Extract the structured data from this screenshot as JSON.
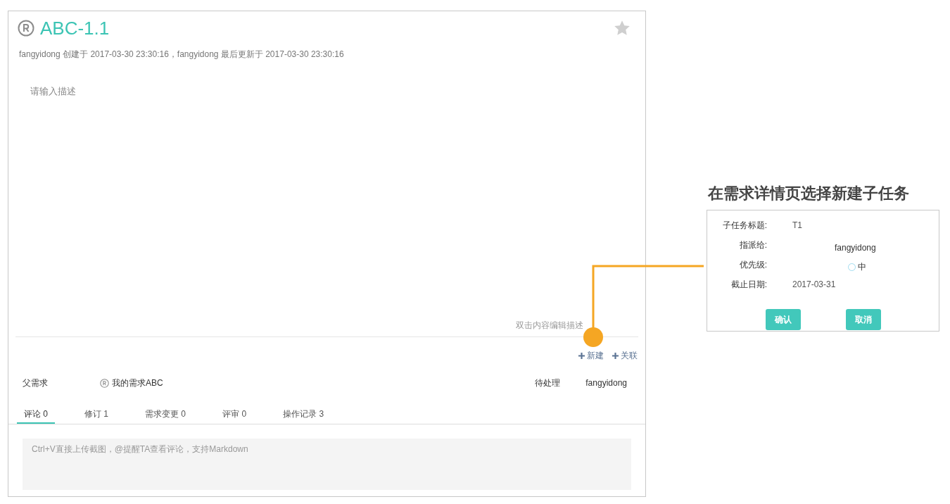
{
  "issue": {
    "title": "ABC-1.1",
    "starred": false,
    "meta": "fangyidong 创建于 2017-03-30 23:30:16，fangyidong 最后更新于 2017-03-30 23:30:16",
    "description_placeholder": "请输入描述",
    "edit_hint": "双击内容编辑描述"
  },
  "actions": [
    "新建",
    "关联"
  ],
  "parent": {
    "label": "父需求",
    "name": "我的需求ABC",
    "status": "待处理",
    "owner": "fangyidong"
  },
  "tabs": [
    {
      "label": "评论 0",
      "selected": true
    },
    {
      "label": "修订 1",
      "selected": false
    },
    {
      "label": "需求变更 0",
      "selected": false
    },
    {
      "label": "评审 0",
      "selected": false
    },
    {
      "label": "操作记录 3",
      "selected": false
    }
  ],
  "comment": {
    "placeholder": "Ctrl+V直接上传截图，@提醒TA查看评论，支持Markdown"
  },
  "annotation": {
    "caption": "在需求详情页选择新建子任务",
    "fields": [
      {
        "kind": "text",
        "label": "子任务标题:",
        "value": "T1"
      },
      {
        "kind": "center",
        "label": "指派给:",
        "value": "fangyidong"
      },
      {
        "kind": "radio",
        "label": "优先级:",
        "value": "中",
        "selected": false
      },
      {
        "kind": "text",
        "label": "截止日期:",
        "value": "2017-03-31"
      }
    ],
    "buttons": [
      "确认",
      "取消"
    ]
  }
}
